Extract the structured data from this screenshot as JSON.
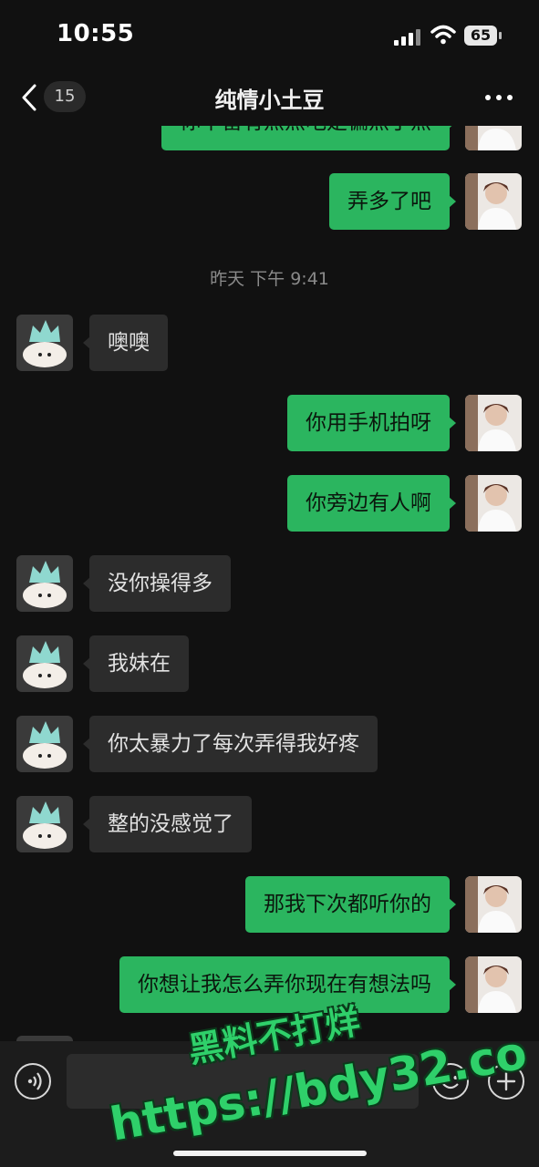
{
  "status_bar": {
    "time": "10:55",
    "battery": "65"
  },
  "nav": {
    "back_count": "15",
    "title": "纯情小土豆"
  },
  "messages": [
    {
      "side": "me",
      "text": "你不留有点点吧是偏点了点"
    },
    {
      "side": "me",
      "text": "弄多了吧"
    },
    {
      "side": "time",
      "text": "昨天 下午 9:41"
    },
    {
      "side": "them",
      "text": "噢噢"
    },
    {
      "side": "me",
      "text": "你用手机拍呀"
    },
    {
      "side": "me",
      "text": "你旁边有人啊"
    },
    {
      "side": "them",
      "text": "没你操得多"
    },
    {
      "side": "them",
      "text": "我妹在"
    },
    {
      "side": "them",
      "text": "你太暴力了每次弄得我好疼"
    },
    {
      "side": "them",
      "text": "整的没感觉了"
    },
    {
      "side": "me",
      "text": "那我下次都听你的"
    },
    {
      "side": "me",
      "text": "你想让我怎么弄你现在有想法吗"
    }
  ],
  "watermark": {
    "line1": "黑料不打烊",
    "line2": "https://bdy32.co"
  },
  "colors": {
    "bubble_me": "#2bb55f",
    "bubble_them": "#2c2c2c",
    "background": "#111111"
  },
  "icons": {
    "back": "chevron-left-icon",
    "more": "more-dots-icon",
    "voice": "voice-icon",
    "emoji": "emoji-icon",
    "plus": "plus-icon"
  }
}
